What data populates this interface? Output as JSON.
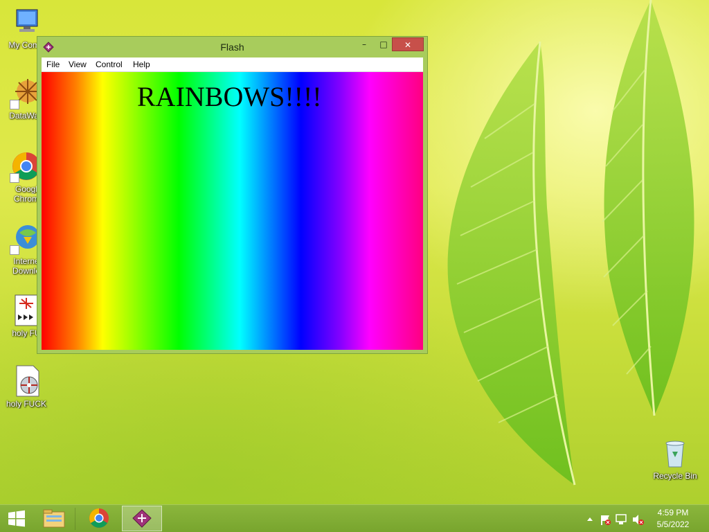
{
  "desktop": {
    "icons": [
      {
        "label": "My Comp"
      },
      {
        "label": "DataWag"
      },
      {
        "label": "Googl"
      },
      {
        "label": "Chrom"
      },
      {
        "label": "Interne"
      },
      {
        "label": "Downlo"
      },
      {
        "label": "holy FU"
      },
      {
        "label": "holy FUCK"
      },
      {
        "label": "Recycle Bin"
      }
    ]
  },
  "window": {
    "title": "Flash",
    "menu": [
      "File",
      "View",
      "Control",
      "Help"
    ],
    "minimize_glyph": "–",
    "maximize_glyph": "□",
    "close_glyph": "✕",
    "stage": {
      "headline": "RAINBOWS!!!!"
    }
  },
  "taskbar": {
    "apps": [
      {
        "name": "file-explorer-icon"
      },
      {
        "name": "chrome-icon"
      },
      {
        "name": "flash-player-icon"
      }
    ],
    "clock": {
      "time": "4:59 PM",
      "date": "5/5/2022"
    }
  },
  "colors": {
    "titlebar": "#a8cc5c",
    "close_button": "#c7504a",
    "taskbar": "#80ad34"
  }
}
